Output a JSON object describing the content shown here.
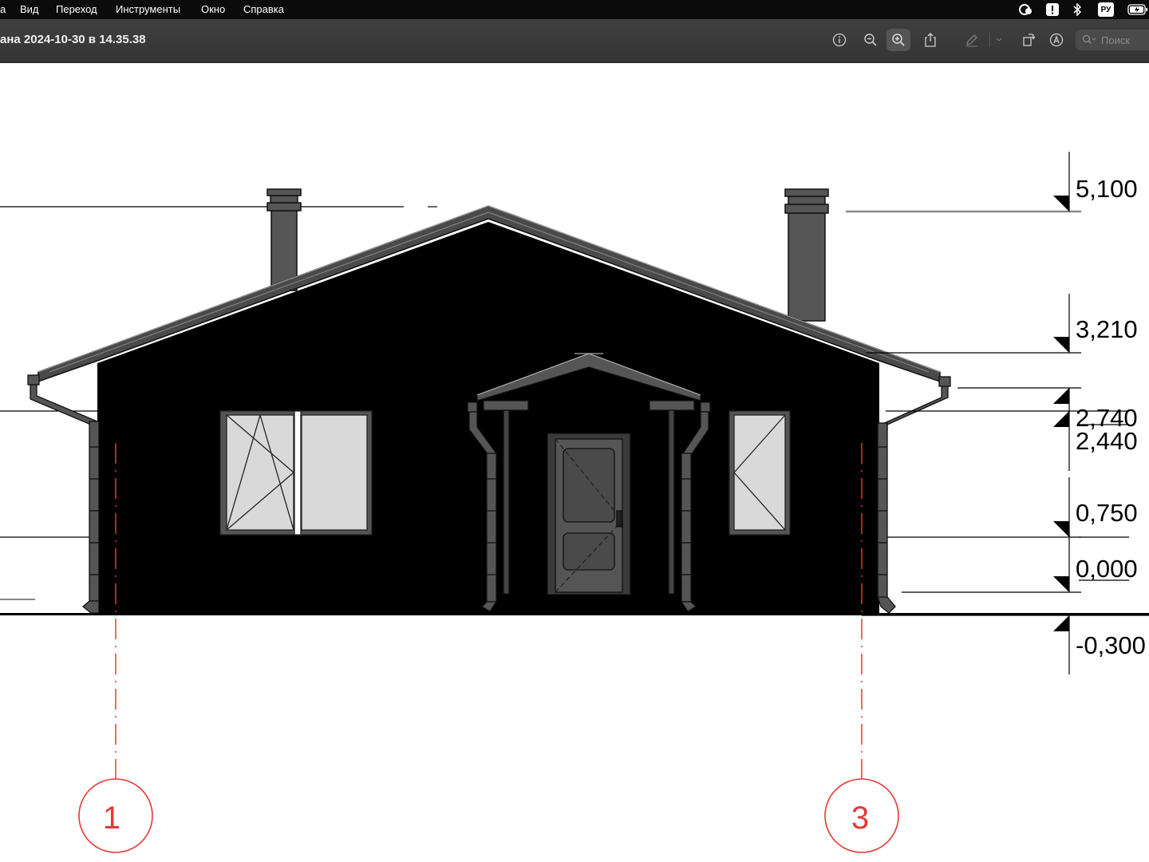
{
  "menubar": {
    "items": [
      {
        "label": "а"
      },
      {
        "label": "Вид"
      },
      {
        "label": "Переход"
      },
      {
        "label": "Инструменты"
      },
      {
        "label": "Окно"
      },
      {
        "label": "Справка"
      }
    ],
    "tray": {
      "input_source": "РУ",
      "icons": [
        "creative-cloud-icon",
        "exclamation-icon",
        "bluetooth-icon",
        "keyboard-layout-icon",
        "battery-icon"
      ]
    }
  },
  "toolbar": {
    "title": "ана 2024-10-30 в 14.35.38",
    "buttons": [
      "info-icon",
      "zoom-out-icon",
      "zoom-in-icon",
      "share-icon",
      "markup-pen-icon",
      "chevron-down-icon",
      "rotate-icon",
      "annotate-icon"
    ],
    "search_placeholder": "Поиск"
  },
  "drawing": {
    "elevations": [
      "5,100",
      "3,210",
      "2,740",
      "2,440",
      "0,750",
      "0,000",
      "-0,300"
    ],
    "axes": [
      "1",
      "3"
    ],
    "colors": {
      "axis": "#e53935",
      "facade": "#000000",
      "roof": "#4a4a4a",
      "glass": "#d9d9d9"
    }
  }
}
